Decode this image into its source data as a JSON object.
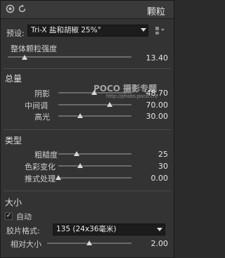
{
  "header": {
    "title": "颗粒"
  },
  "preset": {
    "label": "预设:",
    "value": "Tri-X 盐和胡椒 25%°"
  },
  "overall": {
    "label": "整体颗粒强度",
    "value": "13.40",
    "level": 0.134
  },
  "amount": {
    "title": "总量",
    "sliders": [
      {
        "label": "阴影",
        "value": "48.70",
        "level": 0.487
      },
      {
        "label": "中间调",
        "value": "70.00",
        "level": 0.7
      },
      {
        "label": "高光",
        "value": "30.00",
        "level": 0.3
      }
    ]
  },
  "type": {
    "title": "类型",
    "sliders": [
      {
        "label": "粗糙度",
        "value": "25",
        "level": 0.25
      },
      {
        "label": "色彩变化",
        "value": "30",
        "level": 0.3
      },
      {
        "label": "推式处理",
        "value": "0.00",
        "level": 0.0
      }
    ]
  },
  "size": {
    "title": "大小",
    "auto_label": "自动",
    "auto_checked": true,
    "film_label": "胶片格式:",
    "film_value": "135 (24x36毫米)",
    "relative_label": "相对大小",
    "relative_value": "2.00",
    "relative_level": 0.5
  },
  "watermark": {
    "brand": "POCO 摄影专题",
    "url": "http://photo.poco.cn/"
  }
}
